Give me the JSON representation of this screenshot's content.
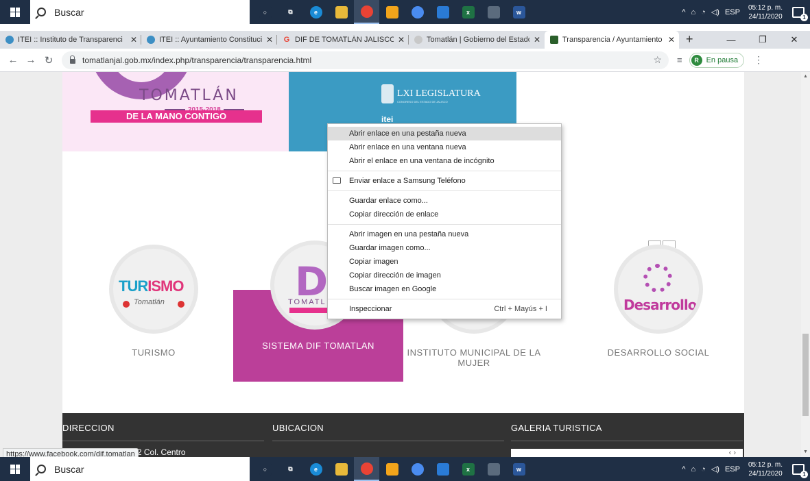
{
  "taskbar": {
    "search_placeholder": "Buscar",
    "tray": {
      "language": "ESP",
      "time": "05:12 p. m.",
      "date": "24/11/2020"
    },
    "apps": [
      {
        "name": "cortana",
        "color": "#1f2f45",
        "glyph": "○"
      },
      {
        "name": "task-view",
        "color": "#1f2f45",
        "glyph": "⧉"
      },
      {
        "name": "edge",
        "color": "#1a8bd6",
        "glyph": "e"
      },
      {
        "name": "file-explorer",
        "color": "#e8b93a",
        "glyph": ""
      },
      {
        "name": "chrome",
        "color": "#e94335",
        "glyph": ""
      },
      {
        "name": "store",
        "color": "#f3a51b",
        "glyph": ""
      },
      {
        "name": "chrome-2",
        "color": "#4a8cf0",
        "glyph": ""
      },
      {
        "name": "mail",
        "color": "#2a7bd6",
        "glyph": ""
      },
      {
        "name": "excel",
        "color": "#1f7244",
        "glyph": "x"
      },
      {
        "name": "calculator",
        "color": "#5b6b7d",
        "glyph": ""
      },
      {
        "name": "word",
        "color": "#2b579a",
        "glyph": "w"
      }
    ]
  },
  "tabs": [
    {
      "title": "ITEI :: Instituto de Transparenci",
      "fav": "#3d8fc4",
      "active": false
    },
    {
      "title": "ITEI :: Ayuntamiento Constitucio",
      "fav": "#3d8fc4",
      "active": false
    },
    {
      "title": "DIF DE TOMATLÁN JALISCO AD",
      "fav": "#e94335",
      "fav_letter": "G",
      "active": false
    },
    {
      "title": "Tomatlán | Gobierno del Estado",
      "fav": "#c8c8c8",
      "active": false
    },
    {
      "title": "Transparencia / Ayuntamiento",
      "fav": "#2b5f2b",
      "active": true
    }
  ],
  "address_bar": {
    "url": "tomatlanjal.gob.mx/index.php/transparencia/transparencia.html",
    "profile_initial": "R",
    "profile_status": "En pausa"
  },
  "page": {
    "banner_dif": {
      "name": "TOMATLÁN",
      "years": "2015-2018",
      "slogan": "DE LA MANO CONTIGO"
    },
    "banner_itei": {
      "legislature": "LXI LEGISLATURA",
      "sub": "CONGRESO DEL ESTADO DE JALISCO",
      "logo": "itei"
    },
    "cards": [
      {
        "caption": "TURISMO",
        "logo_text_1": "TUR",
        "logo_text_2": "ISMO",
        "logo_sub": "Tomatlán"
      },
      {
        "caption": "SISTEMA DIF TOMATLAN",
        "logo_text": "DIF",
        "logo_sub": "TOMATL"
      },
      {
        "caption": "INSTITUTO MUNICIPAL DE LA MUJER"
      },
      {
        "caption": "DESARROLLO SOCIAL",
        "logo_text": "Desarrollo"
      }
    ],
    "carousel": {
      "prev": "‹",
      "next": "›"
    },
    "footer": {
      "col1": "DIRECCION",
      "col2": "UBICACION",
      "col3": "GALERIA TURISTICA",
      "address": "pal. Constitución N° 2 Col. Centro",
      "gallery_nav": "‹ ›"
    },
    "status_url": "https://www.facebook.com/dif.tomatlan"
  },
  "context_menu": {
    "items": [
      {
        "label": "Abrir enlace en una pestaña nueva",
        "hover": true
      },
      {
        "label": "Abrir enlace en una ventana nueva"
      },
      {
        "label": "Abrir el enlace en una ventana de incógnito"
      },
      {
        "sep": true
      },
      {
        "label": "Enviar enlace a Samsung Teléfono",
        "icon": "device"
      },
      {
        "sep": true
      },
      {
        "label": "Guardar enlace como..."
      },
      {
        "label": "Copiar dirección de enlace"
      },
      {
        "sep": true
      },
      {
        "label": "Abrir imagen en una pestaña nueva"
      },
      {
        "label": "Guardar imagen como..."
      },
      {
        "label": "Copiar imagen"
      },
      {
        "label": "Copiar dirección de imagen"
      },
      {
        "label": "Buscar imagen en Google"
      },
      {
        "sep": true
      },
      {
        "label": "Inspeccionar",
        "shortcut": "Ctrl + Mayús + I"
      }
    ]
  }
}
